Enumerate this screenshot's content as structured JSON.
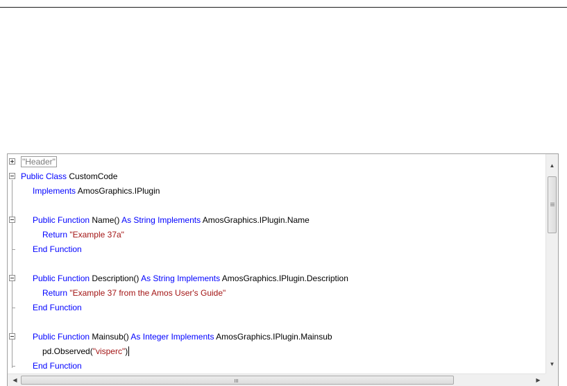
{
  "editor": {
    "lines": [
      {
        "kind": "header",
        "text": "\"Header\""
      },
      {
        "kw1": "Public Class",
        "rest": " CustomCode"
      },
      {
        "kw1": "Implements",
        "rest": " AmosGraphics.IPlugin"
      },
      {},
      {
        "kw1": "Public Function",
        "mid": " Name() ",
        "kw2": "As String Implements",
        "rest": " AmosGraphics.IPlugin.Name"
      },
      {
        "kw1": "Return",
        "str": " \"Example 37a\""
      },
      {
        "kw1": "End Function"
      },
      {},
      {
        "kw1": "Public Function",
        "mid": " Description() ",
        "kw2": "As String Implements",
        "rest": " AmosGraphics.IPlugin.Description"
      },
      {
        "kw1": "Return",
        "str": " \"Example 37 from the Amos User's Guide\""
      },
      {
        "kw1": "End Function"
      },
      {},
      {
        "kw1": "Public Function",
        "mid": " Mainsub() ",
        "kw2": "As Integer Implements",
        "rest": " AmosGraphics.IPlugin.Mainsub"
      },
      {
        "pre": "pd.Observed(",
        "str": "\"visperc\"",
        "post": ")"
      },
      {
        "kw1": "End Function"
      }
    ]
  },
  "icons": {
    "collapsed": "plus-box-icon",
    "expanded": "minus-box-icon",
    "scroll_up": "arrow-up-icon",
    "scroll_down": "arrow-down-icon",
    "scroll_left": "arrow-left-icon",
    "scroll_right": "arrow-right-icon"
  },
  "colors": {
    "keyword": "#0000ff",
    "string": "#a31515",
    "text": "#000000"
  },
  "scroll": {
    "horizontal_grip": "III",
    "vertical_grip": "≡"
  }
}
